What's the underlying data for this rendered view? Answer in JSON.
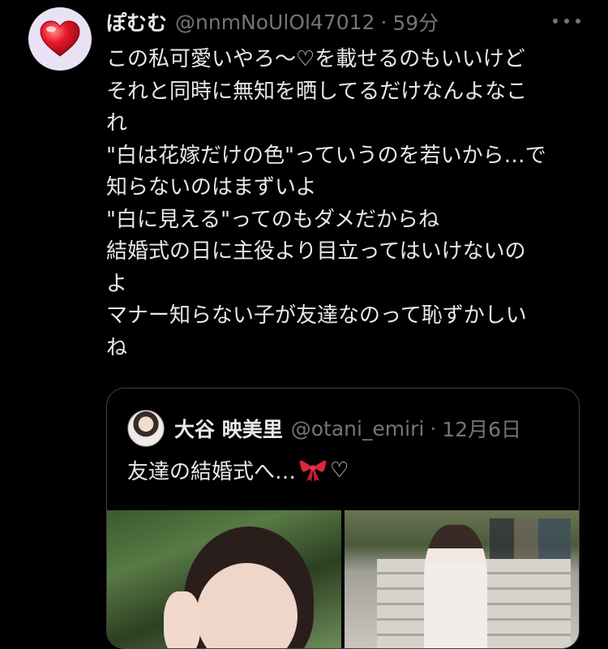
{
  "tweet": {
    "display_name": "ぽむむ",
    "handle": "@nnmNoUlOl47012",
    "separator": "·",
    "time": "59分",
    "avatar_icon": "heart-icon",
    "more_icon": "more-icon",
    "body_lines": [
      "この私可愛いやろ〜♡を載せるのもいいけど",
      "それと同時に無知を晒してるだけなんよなこ",
      "れ",
      "\"白は花嫁だけの色\"っていうのを若いから…で",
      "知らないのはまずいよ",
      "\"白に見える\"ってのもダメだからね",
      "結婚式の日に主役より目立ってはいけないの",
      "よ",
      "マナー知らない子が友達なのって恥ずかしい",
      "ね"
    ]
  },
  "quote": {
    "display_name": "大谷 映美里",
    "handle": "@otani_emiri",
    "separator": "·",
    "date": "12月6日",
    "text": "友達の結婚式へ…",
    "ribbon_icon": "ribbon-icon",
    "heart_suffix": "♡"
  },
  "colors": {
    "background": "#000000",
    "text": "#e7e9ea",
    "muted": "#71767b",
    "border": "#3e4144",
    "heart": "#e8192c",
    "ribbon": "#d9263a"
  }
}
